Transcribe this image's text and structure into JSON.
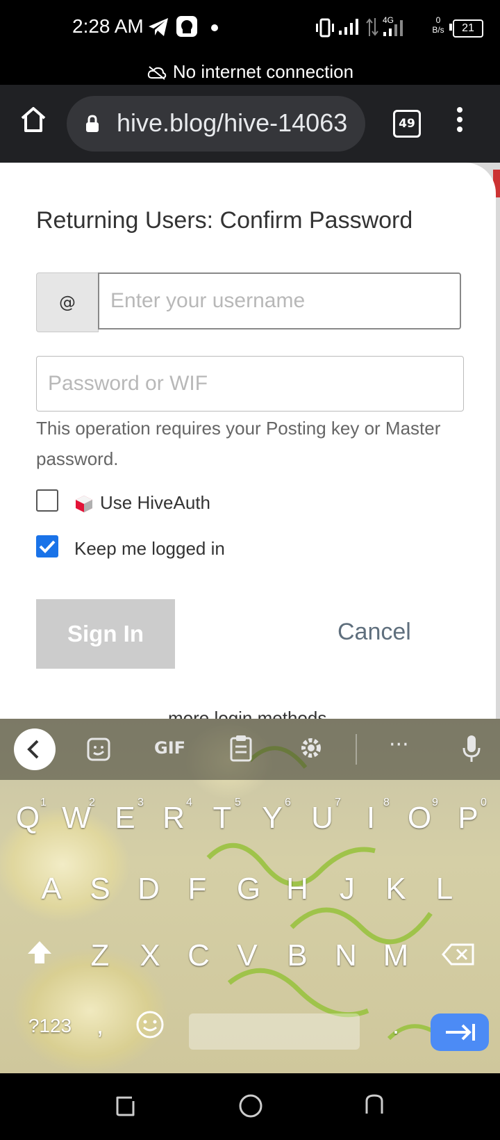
{
  "status": {
    "time": "2:28 AM",
    "network": "4G",
    "speed_value": "0",
    "speed_unit": "B/s",
    "battery": "21"
  },
  "banner": {
    "no_connection": "No internet connection"
  },
  "browser": {
    "url": "hive.blog/hive-14063",
    "tab_count": "49"
  },
  "modal": {
    "title": "Returning Users: Confirm Password",
    "at_symbol": "@",
    "username_placeholder": "Enter your username",
    "password_placeholder": "Password or WIF",
    "hint": "This operation requires your Posting key or Master password.",
    "hiveauth_label": "Use HiveAuth",
    "hiveauth_checked": false,
    "keep_logged_label": "Keep me logged in",
    "keep_logged_checked": true,
    "signin_label": "Sign In",
    "cancel_label": "Cancel",
    "more_login": "more login methods"
  },
  "keyboard": {
    "toolbar": {
      "gif": "GIF",
      "more": "···"
    },
    "row1": [
      "Q",
      "W",
      "E",
      "R",
      "T",
      "Y",
      "U",
      "I",
      "O",
      "P"
    ],
    "row1_hints": [
      "1",
      "2",
      "3",
      "4",
      "5",
      "6",
      "7",
      "8",
      "9",
      "0"
    ],
    "row2": [
      "A",
      "S",
      "D",
      "F",
      "G",
      "H",
      "J",
      "K",
      "L"
    ],
    "row3": [
      "Z",
      "X",
      "C",
      "V",
      "B",
      "N",
      "M"
    ],
    "symbols_label": "?123",
    "comma": ",",
    "period": "."
  },
  "colors": {
    "accent": "#1a73e8",
    "enter_key": "#4c8bf5",
    "signin_disabled": "#cccccc"
  }
}
